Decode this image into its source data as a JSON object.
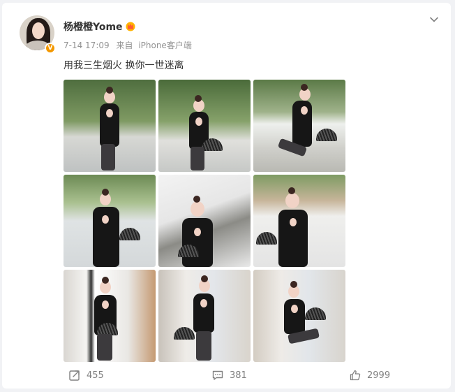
{
  "post": {
    "username": "杨橙橙Yome",
    "time": "7-14 17:09",
    "source_prefix": "来自",
    "source": "iPhone客户端",
    "text": "用我三生烟火  换你一世迷离",
    "verified_badge": "V"
  },
  "photos": [
    {
      "name": "photo-1",
      "scene": "outdoor-trees"
    },
    {
      "name": "photo-2",
      "scene": "outdoor-trees"
    },
    {
      "name": "photo-3",
      "scene": "outdoor-trees"
    },
    {
      "name": "photo-4",
      "scene": "outdoor-trees-building"
    },
    {
      "name": "photo-5",
      "scene": "white-wall"
    },
    {
      "name": "photo-6",
      "scene": "outdoor-hillside"
    },
    {
      "name": "photo-7",
      "scene": "indoor-window"
    },
    {
      "name": "photo-8",
      "scene": "indoor-glassblock"
    },
    {
      "name": "photo-9",
      "scene": "indoor-glassblock"
    }
  ],
  "actions": {
    "repost_count": "455",
    "comment_count": "381",
    "like_count": "2999"
  },
  "colors": {
    "background": "#f1f2f5",
    "card": "#ffffff",
    "text_primary": "#333333",
    "text_secondary": "#939393",
    "verified": "#f39800"
  }
}
